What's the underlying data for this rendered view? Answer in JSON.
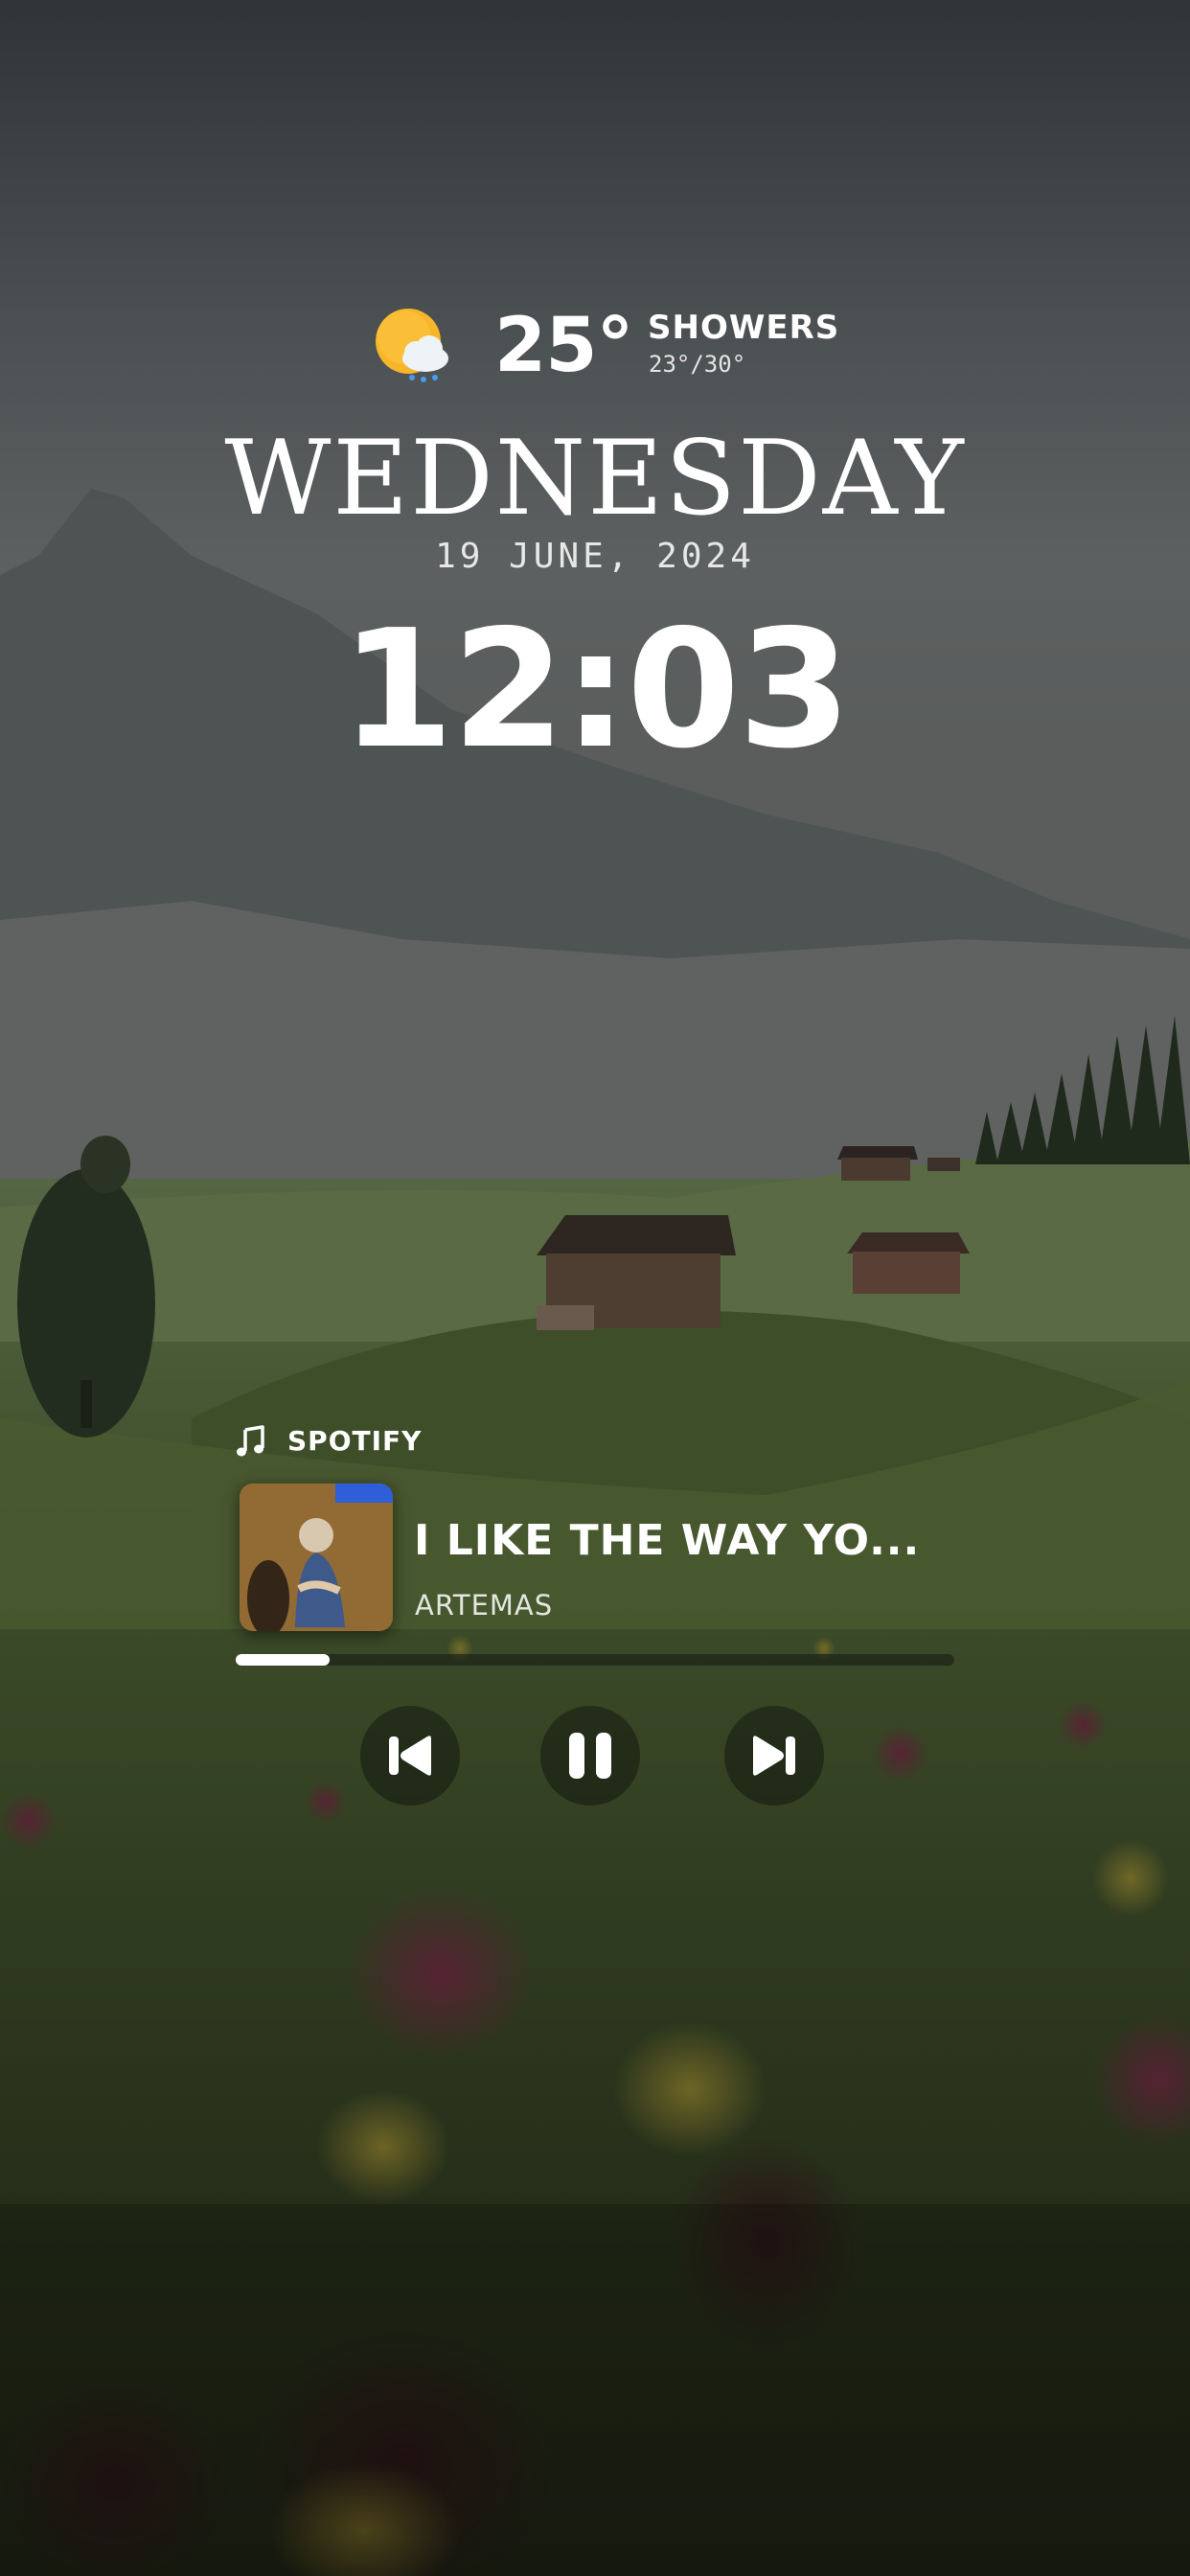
{
  "weather": {
    "icon": "sun-behind-rain-cloud-icon",
    "temperature": "25°",
    "condition": "SHOWERS",
    "range": "23°/30°"
  },
  "lockscreen": {
    "day": "WEDNESDAY",
    "date": "19 JUNE, 2024",
    "time": "12:03"
  },
  "player": {
    "app_icon": "music-note-icon",
    "app_name": "SPOTIFY",
    "track_title": "I LIKE THE WAY YO...",
    "artist": "ARTEMAS",
    "progress": 0.13,
    "controls": [
      "previous-icon",
      "pause-icon",
      "next-icon"
    ]
  },
  "colors": {
    "text": "#ffffff",
    "meadow": "#3c4a2a",
    "sky": "#55595a"
  }
}
